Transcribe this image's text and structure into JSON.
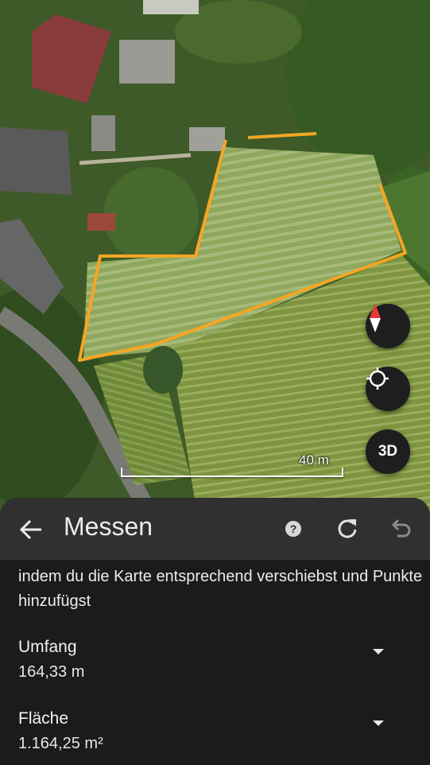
{
  "map": {
    "scale_label": "40 m",
    "compass_icon": "compass-icon",
    "location_icon": "my-location-icon",
    "view_3d_label": "3D",
    "outline_color": "#f5a623"
  },
  "toolbar": {
    "title": "Messen",
    "back_icon": "arrow-back-icon",
    "help_label": "?",
    "redo_icon": "redo-icon",
    "undo_icon": "undo-icon"
  },
  "hint_text": "indem du die Karte entsprechend verschiebst und Punkte hinzufügst",
  "measurements": [
    {
      "label": "Umfang",
      "value": "164,33 m"
    },
    {
      "label": "Fläche",
      "value": "1.164,25 m²"
    }
  ]
}
